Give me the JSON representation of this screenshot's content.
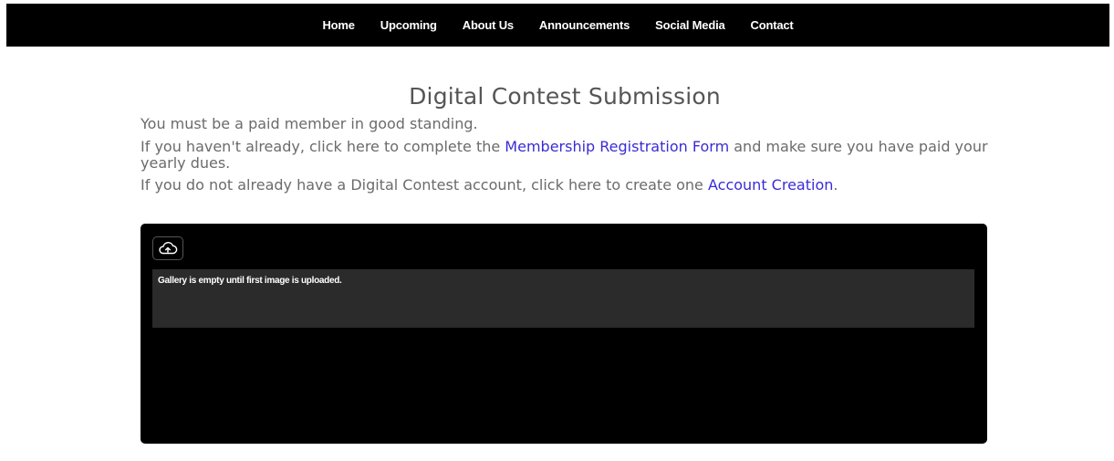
{
  "nav": {
    "items": [
      {
        "label": "Home"
      },
      {
        "label": "Upcoming"
      },
      {
        "label": "About Us"
      },
      {
        "label": "Announcements"
      },
      {
        "label": "Social Media"
      },
      {
        "label": "Contact"
      }
    ]
  },
  "main": {
    "title": "Digital Contest Submission",
    "p1": "You must be a paid member in good standing.",
    "p2_before": "If you haven't already, click here to complete the ",
    "p2_link": "Membership Registration Form",
    "p2_after": " and make sure you have paid your yearly dues.",
    "p3_before": "If you do not already have a Digital Contest account, click here to create one ",
    "p3_link": "Account Creation",
    "p3_after": "."
  },
  "uploader": {
    "upload_icon": "cloud-upload-icon",
    "gallery_empty_message": "Gallery is empty until first image is uploaded."
  },
  "colors": {
    "nav_bg": "#000000",
    "link": "#3a2bd6",
    "text": "#6b6b6b",
    "title": "#555555",
    "uploader_bg": "#000000",
    "gallery_bg": "#2b2b2b"
  }
}
